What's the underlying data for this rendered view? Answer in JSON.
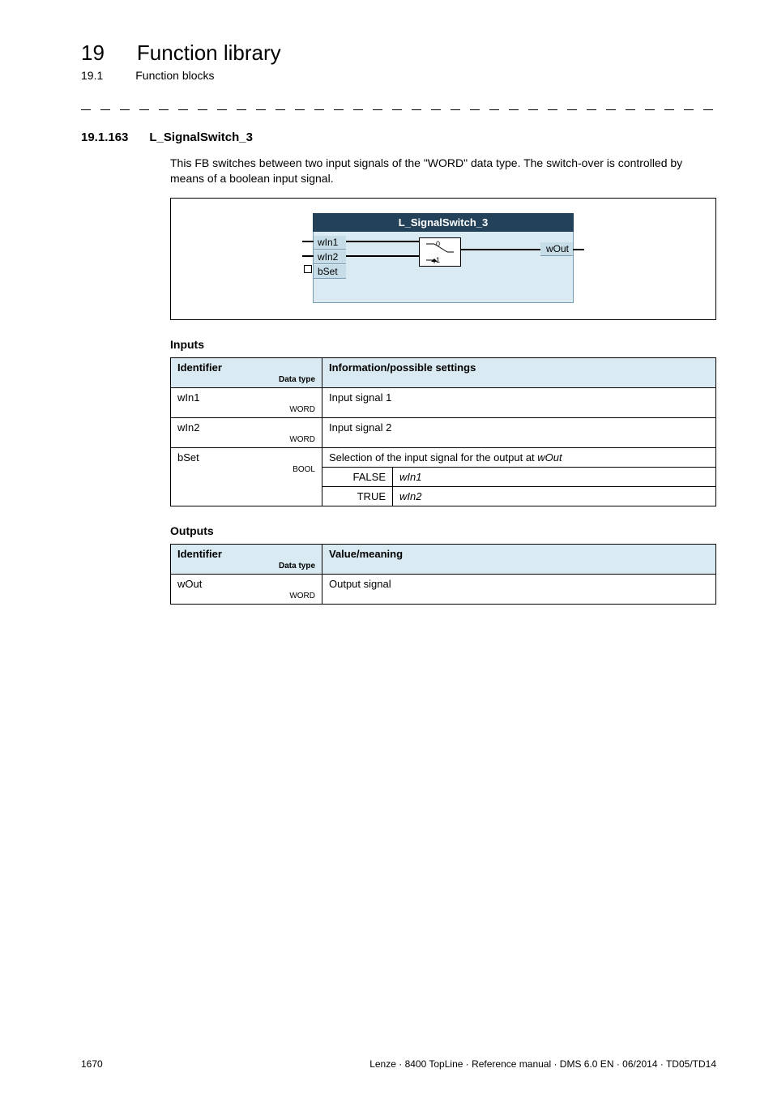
{
  "chapter": {
    "num": "19",
    "title": "Function library"
  },
  "subchapter": {
    "num": "19.1",
    "title": "Function blocks"
  },
  "section": {
    "num": "19.1.163",
    "title": "L_SignalSwitch_3"
  },
  "intro": "This FB switches between two input signals of the \"WORD\" data type. The switch-over is controlled by means of a boolean input signal.",
  "fb": {
    "title": "L_SignalSwitch_3",
    "in1": "wIn1",
    "in2": "wIn2",
    "set": "bSet",
    "out": "wOut",
    "zero": "0",
    "one": "1"
  },
  "inputs": {
    "heading": "Inputs",
    "header_id": "Identifier",
    "header_dt_label": "Data type",
    "header_info": "Information/possible settings",
    "rows": {
      "wIn1": {
        "name": "wIn1",
        "dtype": "WORD",
        "desc": "Input signal 1"
      },
      "wIn2": {
        "name": "wIn2",
        "dtype": "WORD",
        "desc": "Input signal 2"
      },
      "bSet": {
        "name": "bSet",
        "dtype": "BOOL",
        "desc": "Selection of the input signal for the output at ",
        "desc_ref": "wOut",
        "false_label": "FALSE",
        "false_val": "wIn1",
        "true_label": "TRUE",
        "true_val": "wIn2"
      }
    }
  },
  "outputs": {
    "heading": "Outputs",
    "header_id": "Identifier",
    "header_dt_label": "Data type",
    "header_info": "Value/meaning",
    "row": {
      "name": "wOut",
      "dtype": "WORD",
      "desc": "Output signal"
    }
  },
  "footer": {
    "page": "1670",
    "right": "Lenze · 8400 TopLine · Reference manual · DMS 6.0 EN · 06/2014 · TD05/TD14"
  }
}
